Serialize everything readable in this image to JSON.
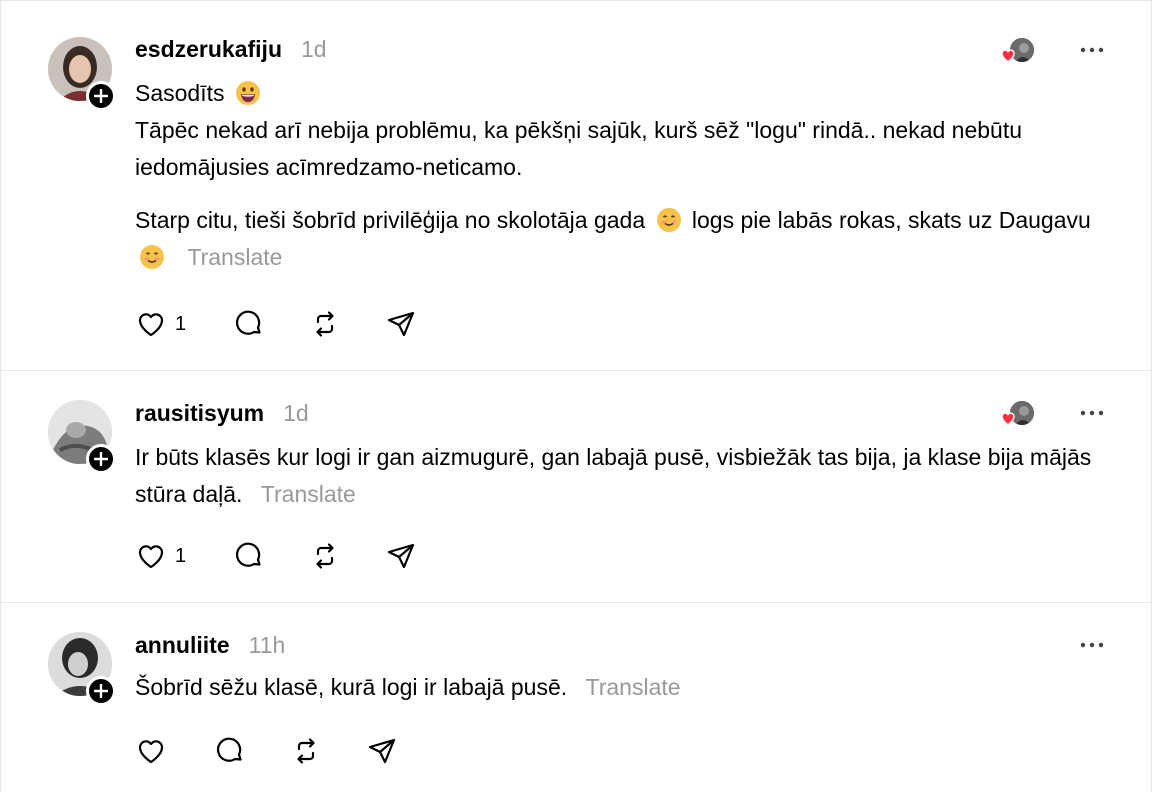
{
  "posts": [
    {
      "username": "esdzerukafiju",
      "timestamp": "1d",
      "lines": [
        "Sasodīts",
        "Tāpēc nekad arī nebija problēmu, ka pēkšņi sajūk, kurš sēž \"logu\" rindā.. nekad nebūtu iedomājusies acīmredzamo-neticamo.",
        "Starp citu, tieši šobrīd privilēģija no skolotāja gada",
        "logs pie labās rokas, skats uz Daugavu"
      ],
      "translate": "Translate",
      "like_count": "1",
      "liked_by_author": true
    },
    {
      "username": "rausitisyum",
      "timestamp": "1d",
      "lines": [
        "Ir būts klasēs kur logi ir gan aizmugurē, gan labajā pusē, visbiežāk tas bija, ja klase bija mājās stūra daļā."
      ],
      "translate": "Translate",
      "like_count": "1",
      "liked_by_author": true
    },
    {
      "username": "annuliite",
      "timestamp": "11h",
      "lines": [
        "Šobrīd sēžu klasē, kurā logi ir labajā pusē."
      ],
      "translate": "Translate",
      "like_count": "",
      "liked_by_author": false
    }
  ],
  "icons": {
    "follow": "plus-icon",
    "more": "more-horizontal-icon",
    "like": "heart-icon",
    "reply": "comment-icon",
    "repost": "repost-icon",
    "share": "send-icon",
    "emoji_grin": "grinning-face-emoji",
    "emoji_smile": "smiling-face-emoji"
  },
  "colors": {
    "text": "#000000",
    "muted": "#999999",
    "divider": "#e6e6e6",
    "heart_red": "#ff3040"
  }
}
